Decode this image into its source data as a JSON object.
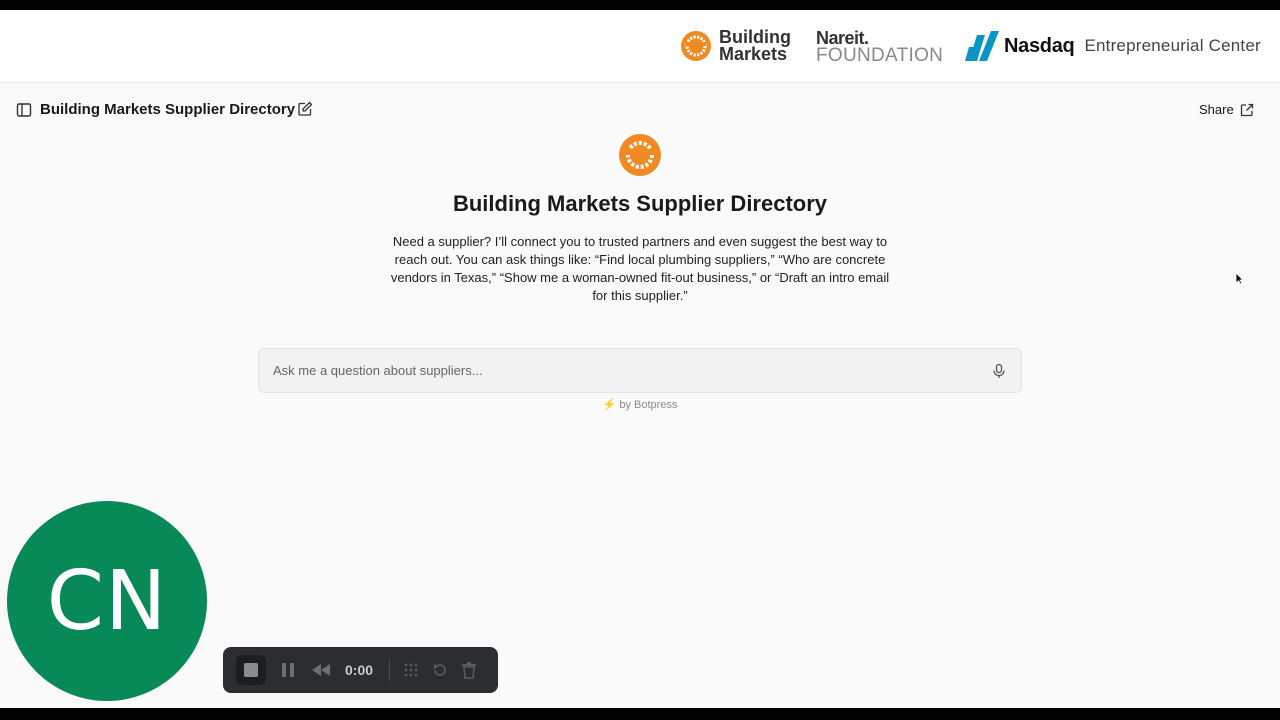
{
  "logos": {
    "building_markets_line1": "Building",
    "building_markets_line2": "Markets",
    "nareit_line1": "Nareit.",
    "nareit_line2": "FOUNDATION",
    "nasdaq": "Nasdaq",
    "nasdaq_center": "Entrepreneurial Center"
  },
  "toolbar": {
    "title": "Building Markets Supplier Directory",
    "share_label": "Share"
  },
  "hero": {
    "title": "Building Markets Supplier Directory",
    "description": "Need a supplier? I’ll connect you to trusted partners and even suggest the best way to reach out. You can ask things like: “Find local plumbing suppliers,” “Who are concrete vendors in Texas,” “Show me a woman-owned fit-out business,” or “Draft an intro email for this supplier.”"
  },
  "chat": {
    "placeholder": "Ask me a question about suppliers...",
    "value": "",
    "powered_by": "by Botpress",
    "powered_icon": "⚡"
  },
  "avatar": {
    "initials": "CN",
    "color": "#078a58"
  },
  "recorder": {
    "time": "0:00"
  },
  "colors": {
    "brand_orange": "#f08a24",
    "nasdaq_blue": "#0996c7"
  }
}
